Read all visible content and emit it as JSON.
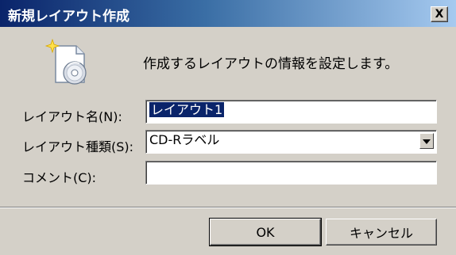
{
  "window": {
    "title": "新規レイアウト作成",
    "close_label": "X"
  },
  "dialog": {
    "intro_text": "作成するレイアウトの情報を設定します。",
    "icon": "new-document-disc-icon"
  },
  "form": {
    "layout_name_label": "レイアウト名(N):",
    "layout_name_value": "レイアウト1",
    "layout_type_label": "レイアウト種類(S):",
    "layout_type_value": "CD-Rラベル",
    "comment_label": "コメント(C):",
    "comment_value": ""
  },
  "buttons": {
    "ok_label": "OK",
    "cancel_label": "キャンセル"
  },
  "colors": {
    "titlebar_start": "#0a246a",
    "titlebar_end": "#a6caf0",
    "dialog_background": "#d4d0c8",
    "selection": "#0a246a"
  }
}
